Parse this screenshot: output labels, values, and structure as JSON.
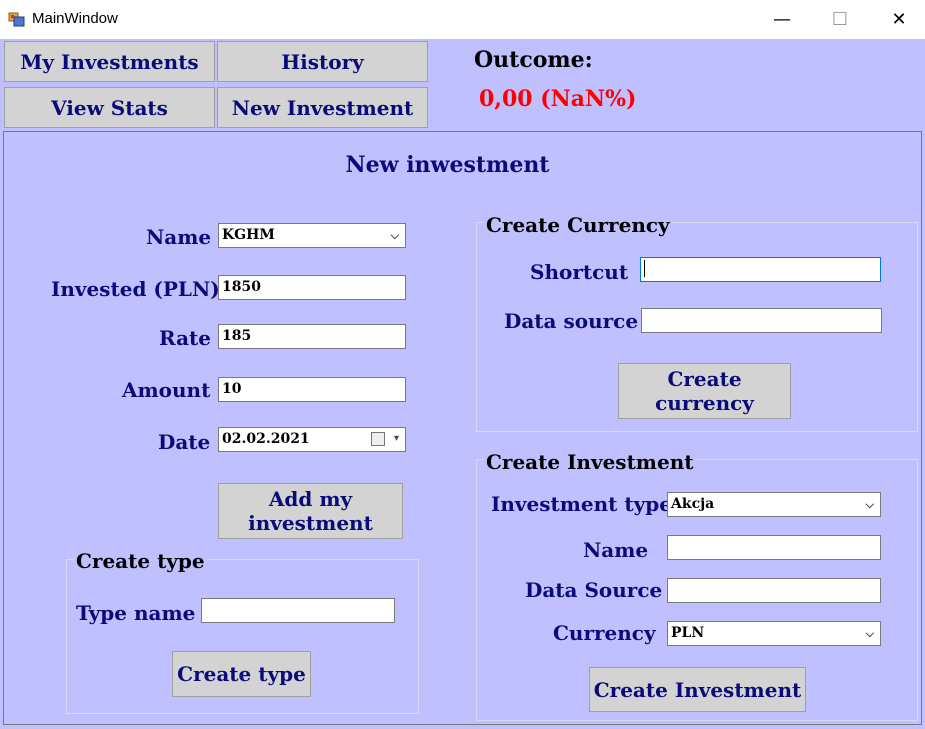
{
  "window": {
    "title": "MainWindow",
    "minimize": "—",
    "maximize": "☐",
    "close": "✕"
  },
  "nav": {
    "my_investments": "My Investments",
    "history": "History",
    "view_stats": "View Stats",
    "new_investment": "New Investment"
  },
  "outcome": {
    "label": "Outcome:",
    "value": "0,00 (NaN%)"
  },
  "form": {
    "heading": "New inwestment",
    "name_label": "Name",
    "name_value": "KGHM",
    "invested_label": "Invested (PLN)",
    "invested_value": "1850",
    "rate_label": "Rate",
    "rate_value": "185",
    "amount_label": "Amount",
    "amount_value": "10",
    "date_label": "Date",
    "date_value": "02.02.2021",
    "add_button_line1": "Add my",
    "add_button_line2": "investment"
  },
  "create_type": {
    "title": "Create type",
    "type_name_label": "Type name",
    "type_name_value": "",
    "button": "Create type"
  },
  "create_currency": {
    "title": "Create Currency",
    "shortcut_label": "Shortcut",
    "shortcut_value": "",
    "data_source_label": "Data source",
    "data_source_value": "",
    "button_line1": "Create",
    "button_line2": "currency"
  },
  "create_investment": {
    "title": "Create Investment",
    "type_label": "Investment type",
    "type_value": "Akcja",
    "name_label": "Name",
    "name_value": "",
    "data_source_label": "Data Source",
    "data_source_value": "",
    "currency_label": "Currency",
    "currency_value": "PLN",
    "button": "Create Investment"
  },
  "colors": {
    "background": "#c0c0ff",
    "label": "#0a0a7a",
    "outcome_value": "#ff0000",
    "button": "#d3d3d3"
  },
  "icons": {
    "app": "app-icon",
    "dropdown": "chevron-down-icon",
    "calendar": "calendar-icon"
  }
}
